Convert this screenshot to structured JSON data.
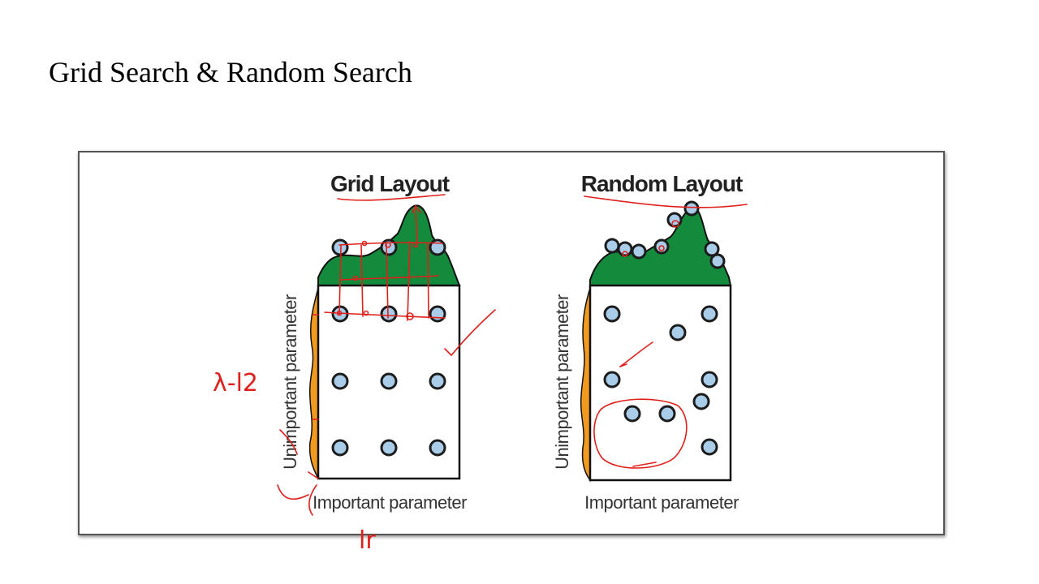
{
  "slide": {
    "title": "Grid Search & Random Search"
  },
  "figure": {
    "grid_panel": {
      "title": "Grid Layout",
      "y_axis_label": "Unimportant parameter",
      "x_axis_label": "Important parameter"
    },
    "random_panel": {
      "title": "Random Layout",
      "y_axis_label": "Unimportant parameter",
      "x_axis_label": "Important parameter"
    }
  },
  "annotations": {
    "left_margin_note": "λ-l2",
    "bottom_note": "lr"
  },
  "colors": {
    "fill_green": "#138a3c",
    "fill_orange": "#f29a1e",
    "point_blue": "#a9cce8",
    "ink_red": "#e0201b"
  }
}
